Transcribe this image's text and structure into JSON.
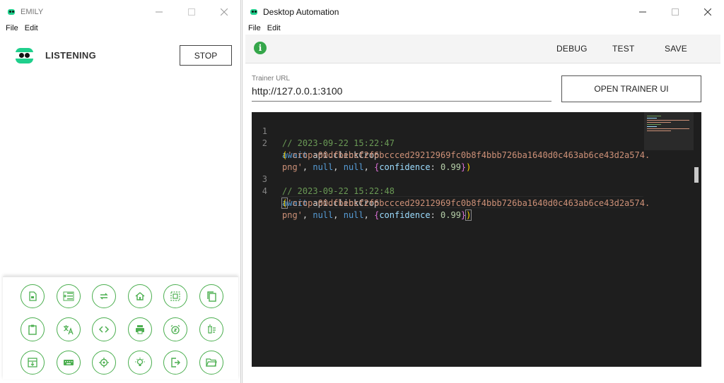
{
  "emily": {
    "window_title": "EMILY",
    "menu": [
      "File",
      "Edit"
    ],
    "status": "LISTENING",
    "stop_label": "STOP",
    "accent_color": "#4caf50",
    "logo_color": "#1fcf8c",
    "tools": [
      {
        "icon": "save-file-icon"
      },
      {
        "icon": "list-add-icon"
      },
      {
        "icon": "repeat-icon"
      },
      {
        "icon": "home-icon"
      },
      {
        "icon": "select-area-icon"
      },
      {
        "icon": "copy-icon"
      },
      {
        "icon": "clipboard-icon"
      },
      {
        "icon": "translate-icon"
      },
      {
        "icon": "code-icon"
      },
      {
        "icon": "print-icon"
      },
      {
        "icon": "alarm-icon"
      },
      {
        "icon": "delete-list-icon"
      },
      {
        "icon": "archive-icon"
      },
      {
        "icon": "keyboard-icon"
      },
      {
        "icon": "crosshair-icon"
      },
      {
        "icon": "lightbulb-icon"
      },
      {
        "icon": "exit-icon"
      },
      {
        "icon": "folder-open-icon"
      }
    ]
  },
  "automation": {
    "window_title": "Desktop Automation",
    "menu": [
      "File",
      "Edit"
    ],
    "toolbar": {
      "info_glyph": "i",
      "debug_label": "DEBUG",
      "test_label": "TEST",
      "save_label": "SAVE"
    },
    "trainer_url_label": "Trainer URL",
    "trainer_url_value": "http://127.0.0.1:3100",
    "open_trainer_label": "OPEN TRAINER UI",
    "editor": {
      "line_numbers": [
        "1",
        "2",
        "3",
        "4"
      ],
      "comment1": "// 2023-09-22 15:22:47",
      "comment2": "// 2023-09-22 15:22:48",
      "await_kw": "await",
      "call_expr": "api.clickCrop",
      "crop_str_part1": "'crop-00dfbebcf2f6bccced29212969fc0b8f4bbb726ba1640d0c463ab6ce43d2a574.",
      "crop_str_part2": "png'",
      "null_kw": "null",
      "confidence_key": "confidence",
      "confidence_value": "0.99"
    },
    "colors": {
      "editor_bg": "#1e1e1e",
      "comment": "#6a9955",
      "string": "#ce9178",
      "keyword": "#569cd6",
      "info": "#35a64a"
    }
  }
}
